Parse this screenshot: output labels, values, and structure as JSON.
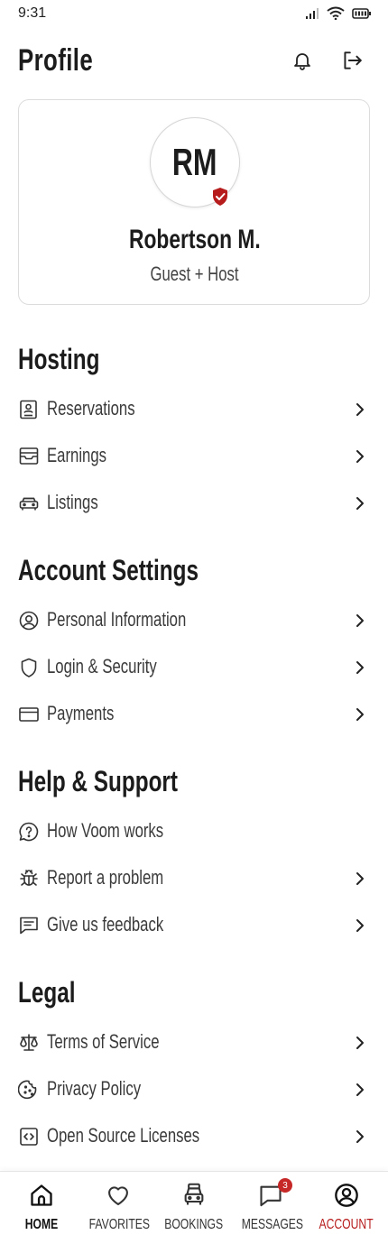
{
  "status_bar": {
    "time": "9:31"
  },
  "header": {
    "title": "Profile"
  },
  "profile": {
    "initials": "RM",
    "name": "Robertson M.",
    "role": "Guest + Host"
  },
  "sections": {
    "hosting": {
      "title": "Hosting",
      "items": [
        {
          "label": "Reservations",
          "icon": "reservations-icon"
        },
        {
          "label": "Earnings",
          "icon": "inbox-tray-icon"
        },
        {
          "label": "Listings",
          "icon": "car-icon"
        }
      ]
    },
    "account": {
      "title": "Account Settings",
      "items": [
        {
          "label": "Personal Information",
          "icon": "user-circle-icon"
        },
        {
          "label": "Login & Security",
          "icon": "shield-icon"
        },
        {
          "label": "Payments",
          "icon": "credit-card-icon"
        }
      ]
    },
    "help": {
      "title": "Help & Support",
      "items": [
        {
          "label": "How Voom works",
          "icon": "help-chat-icon"
        },
        {
          "label": "Report a problem",
          "icon": "bug-icon"
        },
        {
          "label": "Give us feedback",
          "icon": "feedback-icon"
        }
      ]
    },
    "legal": {
      "title": "Legal",
      "items": [
        {
          "label": "Terms of Service",
          "icon": "scale-icon"
        },
        {
          "label": "Privacy Policy",
          "icon": "cookie-icon"
        },
        {
          "label": "Open Source Licenses",
          "icon": "code-icon"
        }
      ]
    }
  },
  "nav": {
    "items": [
      {
        "label": "HOME",
        "icon": "home-icon"
      },
      {
        "label": "FAVORITES",
        "icon": "heart-icon"
      },
      {
        "label": "BOOKINGS",
        "icon": "car-front-icon"
      },
      {
        "label": "MESSAGES",
        "icon": "message-icon",
        "badge": "3"
      },
      {
        "label": "ACCOUNT",
        "icon": "account-icon"
      }
    ]
  },
  "colors": {
    "accent": "#b71c1c",
    "badge": "#c62828",
    "text": "#1c1c1c",
    "border": "#dcdcdc"
  }
}
